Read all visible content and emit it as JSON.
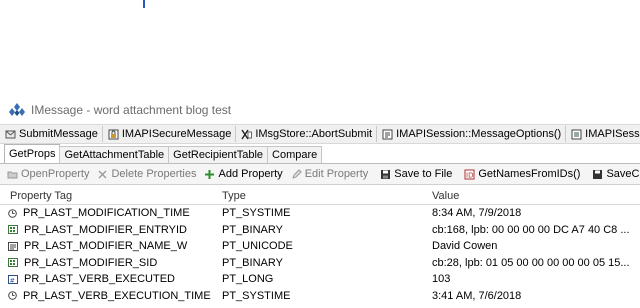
{
  "window": {
    "title": "IMessage - word attachment blog test"
  },
  "toolbar1": [
    {
      "label": "SubmitMessage",
      "icon": "submit-icon"
    },
    {
      "label": "IMAPISecureMessage",
      "icon": "secure-message-icon"
    },
    {
      "label": "IMsgStore::AbortSubmit",
      "icon": "abort-submit-icon"
    },
    {
      "label": "IMAPISession::MessageOptions()",
      "icon": "message-options-icon"
    },
    {
      "label": "IMAPISession::I",
      "icon": "session-icon"
    }
  ],
  "tabs": [
    "GetProps",
    "GetAttachmentTable",
    "GetRecipientTable",
    "Compare"
  ],
  "active_tab": "GetProps",
  "toolbar2": [
    {
      "label": "OpenProperty",
      "icon": "open-property-icon",
      "enabled": false
    },
    {
      "label": "Delete Properties",
      "icon": "delete-icon",
      "enabled": false
    },
    {
      "label": "Add Property",
      "icon": "add-property-icon",
      "enabled": true
    },
    {
      "label": "Edit Property",
      "icon": "edit-property-icon",
      "enabled": false
    },
    {
      "label": "Save to File",
      "icon": "save-icon",
      "enabled": true
    },
    {
      "label": "GetNamesFromIDs()",
      "icon": "get-names-icon",
      "enabled": true
    },
    {
      "label": "SaveCh",
      "icon": "save-changes-icon",
      "enabled": true
    }
  ],
  "grid": {
    "columns": [
      "Property Tag",
      "Type",
      "Value"
    ],
    "rows": [
      {
        "tag": "PR_LAST_MODIFICATION_TIME",
        "type": "PT_SYSTIME",
        "value": "8:34 AM, 7/9/2018",
        "icon": "clock-icon"
      },
      {
        "tag": "PR_LAST_MODIFIER_ENTRYID",
        "type": "PT_BINARY",
        "value": "cb:168, lpb: 00 00 00 00 DC A7 40 C8 ...",
        "icon": "binary-icon"
      },
      {
        "tag": "PR_LAST_MODIFIER_NAME_W",
        "type": "PT_UNICODE",
        "value": "David Cowen",
        "icon": "text-icon"
      },
      {
        "tag": "PR_LAST_MODIFIER_SID",
        "type": "PT_BINARY",
        "value": "cb:28, lpb: 01 05 00 00 00 00 00 05 15...",
        "icon": "binary-icon"
      },
      {
        "tag": "PR_LAST_VERB_EXECUTED",
        "type": "PT_LONG",
        "value": "103",
        "icon": "number-icon"
      },
      {
        "tag": "PR_LAST_VERB_EXECUTION_TIME",
        "type": "PT_SYSTIME",
        "value": "3:41 AM, 7/6/2018",
        "icon": "clock-icon"
      }
    ]
  }
}
